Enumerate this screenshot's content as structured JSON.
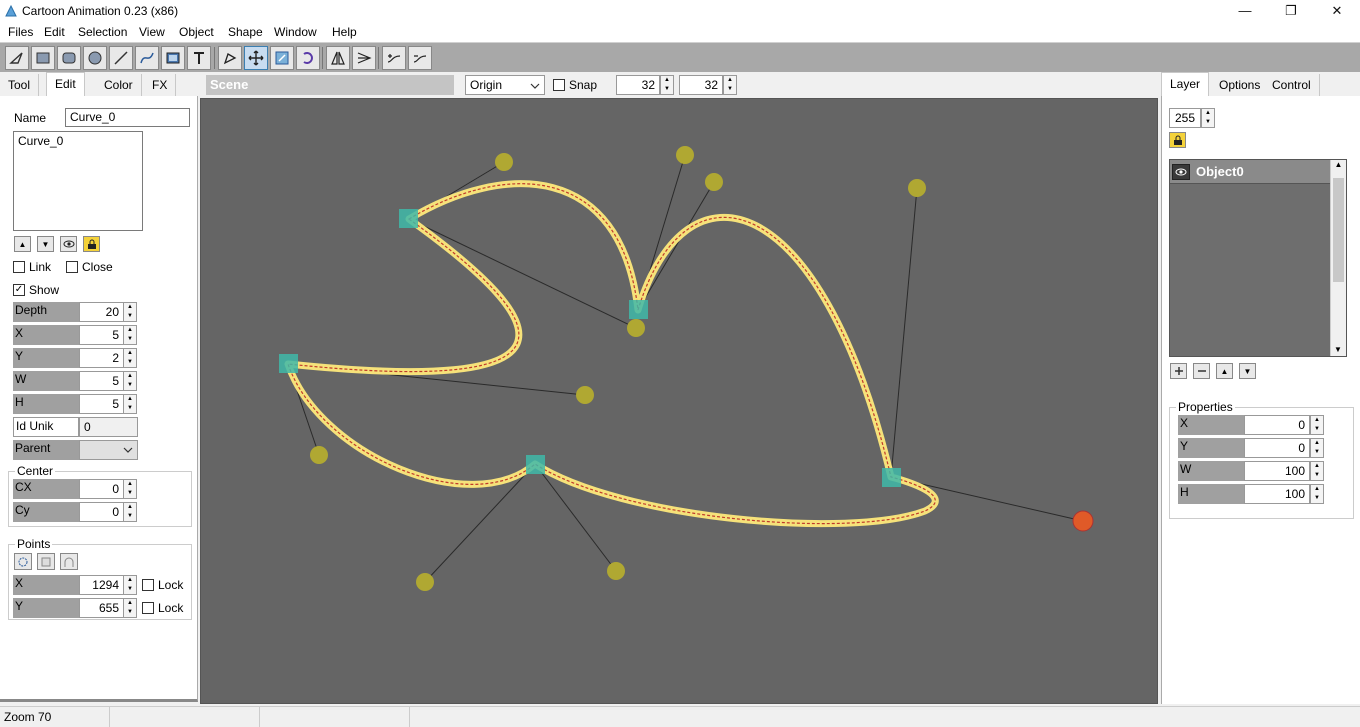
{
  "window": {
    "title": "Cartoon Animation 0.23 (x86)",
    "minimize": "—",
    "maximize": "❐",
    "close": "✕"
  },
  "menu": [
    "Files",
    "Edit",
    "Selection",
    "View",
    "Object",
    "Shape",
    "Window",
    "Help"
  ],
  "toolbar": {
    "tools": [
      "select-arrow-icon",
      "rectangle-icon",
      "rounded-rectangle-icon",
      "ellipse-icon",
      "line-icon",
      "curve-icon",
      "image-icon",
      "text-icon",
      "pen-edit-icon",
      "move-icon",
      "scale-icon",
      "rotate-icon",
      "flip-icon",
      "align-icon",
      "node-add-icon",
      "node-remove-icon"
    ]
  },
  "left_tabs": [
    "Tool",
    "Edit",
    "Color",
    "FX"
  ],
  "left_active_tab": "Edit",
  "edit": {
    "name_label": "Name",
    "name_value": "Curve_0",
    "list_items": [
      "Curve_0"
    ],
    "link_label": "Link",
    "close_label": "Close",
    "show_label": "Show",
    "show_checked": true,
    "depth_label": "Depth",
    "depth": "20",
    "x_label": "X",
    "x": "5",
    "y_label": "Y",
    "y": "2",
    "w_label": "W",
    "w": "5",
    "h_label": "H",
    "h": "5",
    "idunik_label": "Id Unik",
    "idunik": "0",
    "parent_label": "Parent",
    "center_title": "Center",
    "cx_label": "CX",
    "cx": "0",
    "cy_label": "Cy",
    "cy": "0",
    "points_title": "Points",
    "px_label": "X",
    "px": "1294",
    "py_label": "Y",
    "py": "655",
    "lock_label": "Lock"
  },
  "scenebar": {
    "scene_label": "Scene",
    "origin_value": "Origin",
    "snap_label": "Snap",
    "grid_x": "32",
    "grid_y": "32"
  },
  "right_tabs": [
    "Layer",
    "Options",
    "Control"
  ],
  "right_active_tab": "Layer",
  "layer": {
    "alpha": "255",
    "objects": [
      "Object0"
    ],
    "properties_title": "Properties",
    "x_label": "X",
    "x": "0",
    "y_label": "Y",
    "y": "0",
    "w_label": "W",
    "w": "100",
    "h_label": "H",
    "h": "100"
  },
  "status": {
    "zoom": "Zoom 70"
  },
  "colors": {
    "canvas_bg": "#656565",
    "curve_outer": "#f6e27a",
    "curve_dash": "#c0392b",
    "anchor": "#3fb8a8",
    "handle": "#b0a832",
    "handle_selected": "#e05a28"
  }
}
